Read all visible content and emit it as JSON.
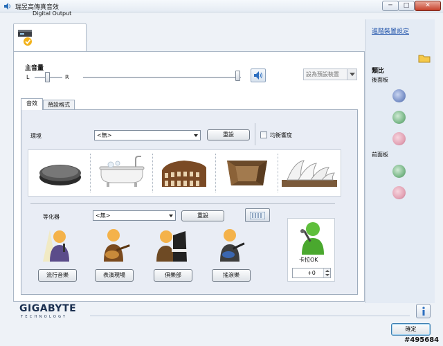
{
  "window": {
    "title": "瑞昱高傳真音效",
    "minimize": "─",
    "maximize": "□",
    "close": "✕"
  },
  "device_tab": {
    "label": "Digital Output"
  },
  "main_volume": {
    "label": "主音量",
    "left": "L",
    "right": "R",
    "set_default_label": "設為預設裝置"
  },
  "subtabs": [
    {
      "label": "音效"
    },
    {
      "label": "預設格式"
    }
  ],
  "environment": {
    "label": "環境",
    "selected": "<無>",
    "reset_label": "重設",
    "equalize_loudness_label": "均衡響度"
  },
  "equalizer": {
    "label": "等化器",
    "selected": "<無>",
    "reset_label": "重設",
    "presets": [
      {
        "label": "流行音樂"
      },
      {
        "label": "表演現場"
      },
      {
        "label": "俱樂部"
      },
      {
        "label": "搖滾樂"
      }
    ]
  },
  "karaoke": {
    "label": "卡拉OK",
    "value": "+0"
  },
  "right_panel": {
    "advanced_settings": "進階裝置設定",
    "analog_label": "類比",
    "rear_panel_label": "後面板",
    "front_panel_label": "前面板"
  },
  "footer": {
    "brand": "GIGABYTE",
    "brand_sub": "TECHNOLOGY",
    "ok_label": "確定",
    "watermark": "#495684"
  },
  "colors": {
    "jack_blue": "#7c93c9",
    "jack_green": "#7cb98a",
    "jack_pink": "#e3a3b5"
  }
}
